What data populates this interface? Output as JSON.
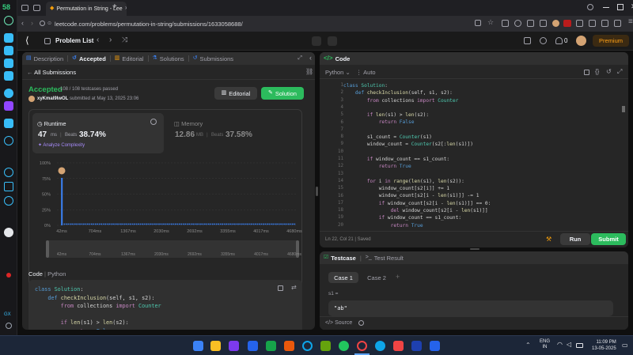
{
  "rail": {
    "badge": "58"
  },
  "browser": {
    "tab_title": "Permutation in String - Lee",
    "new_tab_symbol": "+",
    "url": "leetcode.com/problems/permutation-in-string/submissions/1633058688/"
  },
  "header": {
    "problem_list": "Problem List",
    "fire_count": "0",
    "premium": "Premium"
  },
  "left_tabs": [
    "Description",
    "Accepted",
    "Editorial",
    "Solutions",
    "Submissions"
  ],
  "all_submissions": "All Submissions",
  "submission": {
    "status": "Accepted",
    "testcases": "108 / 108 testcases passed",
    "user": "xyKmal9IwOL",
    "submitted_text": "submitted at May 13, 2025 23:06",
    "editorial_btn": "Editorial",
    "solution_btn": "Solution"
  },
  "runtime": {
    "label": "Runtime",
    "value": "47",
    "unit": "ms",
    "sep": "|",
    "beats_label": "Beats",
    "beats_value": "38.74%",
    "analyze": "Analyze Complexity"
  },
  "memory": {
    "label": "Memory",
    "value": "12.86",
    "unit": "MB",
    "sep": "|",
    "beats_label": "Beats",
    "beats_value": "37.58%"
  },
  "chart_data": {
    "type": "bar",
    "y_ticks": [
      "100%",
      "75%",
      "50%",
      "25%",
      "0%"
    ],
    "x_ticks": [
      "42ms",
      "704ms",
      "1367ms",
      "2030ms",
      "2692ms",
      "3355ms",
      "4017ms",
      "4680ms"
    ],
    "ylim": [
      0,
      100
    ],
    "highlight_category": "42ms",
    "highlight_value": 76,
    "baseline_value": 1
  },
  "left_code": {
    "header_code": "Code",
    "header_sep": "|",
    "header_lang": "Python",
    "lines": [
      "class Solution:",
      "    def checkInclusion(self, s1, s2):",
      "        from collections import Counter",
      "",
      "        if len(s1) > len(s2):",
      "            return False"
    ]
  },
  "right": {
    "title": "Code",
    "lang": "Python",
    "auto": "Auto",
    "line_numbers": [
      "1",
      "2",
      "3",
      "4",
      "5",
      "6",
      "7",
      "8",
      "9",
      "10",
      "11",
      "12",
      "13",
      "14",
      "15",
      "16",
      "17",
      "18",
      "19",
      "20"
    ],
    "lines": [
      "class Solution:",
      "    def checkInclusion(self, s1, s2):",
      "        from collections import Counter",
      "",
      "        if len(s1) > len(s2):",
      "            return False",
      "",
      "        s1_count = Counter(s1)",
      "        window_count = Counter(s2[:len(s1)])",
      "",
      "        if window_count == s1_count:",
      "            return True",
      "",
      "        for i in range(len(s1), len(s2)):",
      "            window_count[s2[i]] += 1",
      "            window_count[s2[i - len(s1)]] -= 1",
      "            if window_count[s2[i - len(s1)]] == 0:",
      "                del window_count[s2[i - len(s1)]]",
      "            if window_count == s1_count:",
      "                return True"
    ],
    "status": "Ln 22, Col 21",
    "status_sep": "|",
    "saved": "Saved",
    "run": "Run",
    "submit": "Submit"
  },
  "testcase": {
    "tab1": "Testcase",
    "tab_sep": "|",
    "tab2": "Test Result",
    "case1": "Case 1",
    "case2": "Case 2",
    "add": "+",
    "var_label": "s1 =",
    "var_value": "\"ab\"",
    "source": "Source"
  },
  "taskbar": {
    "lang1": "ENG",
    "lang2": "IN",
    "time": "11:09 PM",
    "date": "13-05-2025"
  }
}
